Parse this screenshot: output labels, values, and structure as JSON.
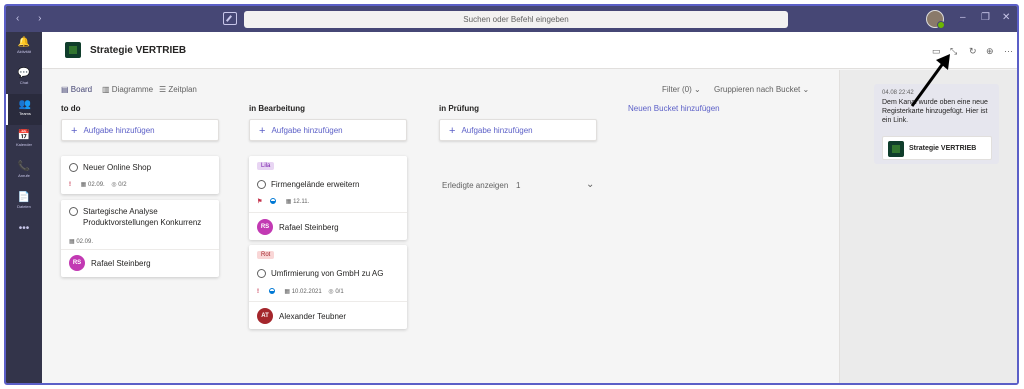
{
  "app": {
    "search_placeholder": "Suchen oder Befehl eingeben",
    "nav_arrows": "‹ ›"
  },
  "rail": [
    {
      "label": "Aktivität",
      "icon": "bell-icon",
      "glyph": "🔔"
    },
    {
      "label": "Chat",
      "icon": "chat-icon",
      "glyph": "💬"
    },
    {
      "label": "Teams",
      "icon": "teams-icon",
      "glyph": "👥"
    },
    {
      "label": "Kalender",
      "icon": "calendar-icon",
      "glyph": "📅"
    },
    {
      "label": "Anrufe",
      "icon": "phone-icon",
      "glyph": "📞"
    },
    {
      "label": "Dateien",
      "icon": "file-icon",
      "glyph": "📄"
    },
    {
      "label": "",
      "icon": "more-icon",
      "glyph": "•••"
    }
  ],
  "header": {
    "title": "Strategie VERTRIEB"
  },
  "toolbar": {
    "board": "Board",
    "charts": "Diagramme",
    "schedule": "Zeitplan",
    "filter": "Filter (0)",
    "group": "Gruppieren nach Bucket"
  },
  "buckets": [
    {
      "title": "to do",
      "add": "Aufgabe hinzufügen",
      "cards": [
        {
          "title": "Neuer Online Shop",
          "date": "02.09.",
          "checklist": "0/2"
        },
        {
          "title": "Startegische Analyse Produktvorstellungen Konkurrenz",
          "date": "02.09.",
          "assignee": "Rafael Steinberg",
          "initials": "RS"
        }
      ]
    },
    {
      "title": "in Bearbeitung",
      "add": "Aufgabe hinzufügen",
      "cards": [
        {
          "label": "Lila",
          "title": "Firmengelände erweitern",
          "date": "12.11.",
          "assignee": "Rafael Steinberg",
          "initials": "RS"
        },
        {
          "label": "Rot",
          "title": "Umfirmierung von GmbH zu AG",
          "date": "10.02.2021",
          "checklist": "0/1",
          "assignee": "Alexander Teubner",
          "initials": "AT"
        }
      ]
    },
    {
      "title": "in Prüfung",
      "add": "Aufgabe hinzufügen",
      "completed_label": "Erledigte anzeigen",
      "completed_count": "1"
    }
  ],
  "new_bucket": "Neuen Bucket hinzufügen",
  "side_panel": {
    "time": "04.08 22:42",
    "message": "Dem Kanal wurde oben eine neue Registerkarte hinzugefügt. Hier ist ein Link.",
    "card_label": "Strategie VERTRIEB"
  },
  "colors": {
    "titlebar": "#464775",
    "rail": "#33344a",
    "accent": "#5b5fc7",
    "label_lila_bg": "#e8d5f3",
    "label_rot_bg": "#f9d6d6",
    "avatar_rs": "#c239b3",
    "avatar_at": "#a4262c"
  }
}
